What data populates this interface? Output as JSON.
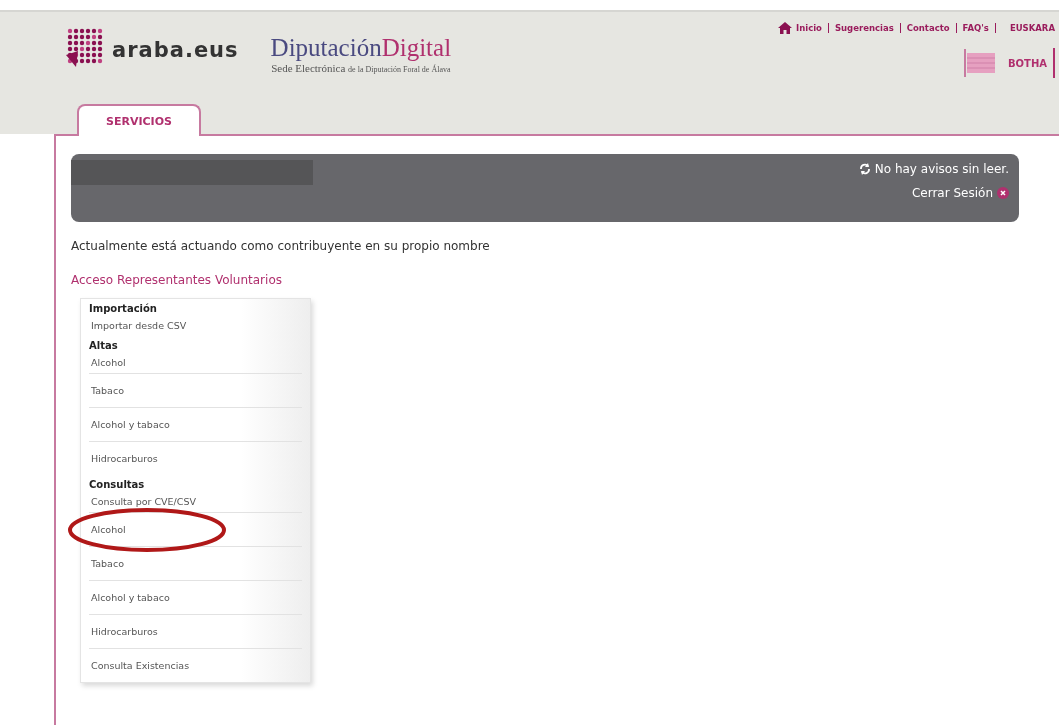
{
  "header": {
    "logo_text": "araba.eus",
    "brand_main": "Diputación",
    "brand_accent": "Digital",
    "subtitle_main": "Sede Electrónica",
    "subtitle_small": "de la Diputación Foral de Álava",
    "top_links": [
      "Inicio",
      "Sugerencias",
      "Contacto",
      "FAQ's",
      "EUSKARA"
    ],
    "botha": "BOTHA"
  },
  "tabs": [
    {
      "label": "SERVICIOS",
      "selected": true
    }
  ],
  "session_bar": {
    "notices": "No hay avisos sin leer.",
    "logout": "Cerrar Sesión"
  },
  "status_text": "Actualmente está actuando como contribuyente en su propio nombre",
  "representatives_link": "Acceso Representantes Voluntarios",
  "menu": [
    {
      "title": "Importación",
      "items": [
        {
          "label": "Importar desde CSV",
          "circled": false
        }
      ]
    },
    {
      "title": "Altas",
      "items": [
        {
          "label": "Alcohol",
          "circled": false
        },
        {
          "label": "Tabaco",
          "circled": false
        },
        {
          "label": "Alcohol y tabaco",
          "circled": false
        },
        {
          "label": "Hidrocarburos",
          "circled": false
        }
      ]
    },
    {
      "title": "Consultas",
      "items": [
        {
          "label": "Consulta por CVE/CSV",
          "circled": false
        },
        {
          "label": "Alcohol",
          "circled": true
        },
        {
          "label": "Tabaco",
          "circled": false
        },
        {
          "label": "Alcohol y tabaco",
          "circled": false
        },
        {
          "label": "Hidrocarburos",
          "circled": false
        },
        {
          "label": "Consulta Existencias",
          "circled": false
        }
      ]
    }
  ]
}
